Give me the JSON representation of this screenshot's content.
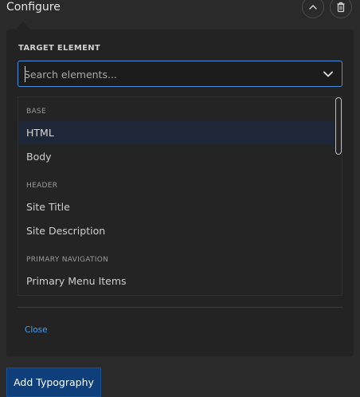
{
  "header": {
    "title": "Configure",
    "collapse_icon": "chevron-up-icon",
    "delete_icon": "trash-icon"
  },
  "panel": {
    "section_label": "TARGET ELEMENT",
    "search": {
      "placeholder": "Search elements...",
      "value": "",
      "dropdown_icon": "chevron-down-icon"
    },
    "groups": [
      {
        "label": "BASE",
        "items": [
          {
            "label": "HTML",
            "selected": true
          },
          {
            "label": "Body",
            "selected": false
          }
        ]
      },
      {
        "label": "HEADER",
        "items": [
          {
            "label": "Site Title",
            "selected": false
          },
          {
            "label": "Site Description",
            "selected": false
          }
        ]
      },
      {
        "label": "PRIMARY NAVIGATION",
        "items": [
          {
            "label": "Primary Menu Items",
            "selected": false
          }
        ]
      }
    ],
    "close_label": "Close"
  },
  "footer": {
    "add_button_label": "Add Typography"
  },
  "colors": {
    "accent_blue": "#4a90d9",
    "button_bg": "#0f3f7a",
    "selected_row": "#1d2738",
    "background": "#2a2a2a"
  }
}
